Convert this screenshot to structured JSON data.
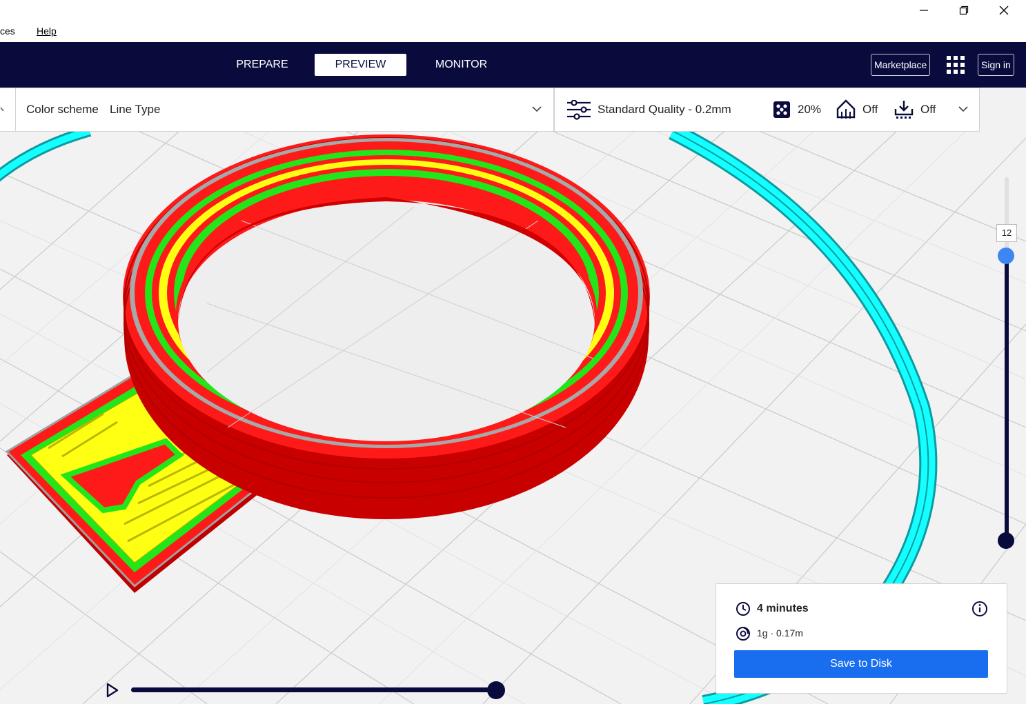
{
  "window_controls": {
    "minimize": "minimize",
    "restore": "restore",
    "close": "close"
  },
  "menu": {
    "items": [
      {
        "label": "ces"
      },
      {
        "label": "Help"
      }
    ]
  },
  "stages": [
    {
      "label": "PREPARE"
    },
    {
      "label": "PREVIEW",
      "active": true
    },
    {
      "label": "MONITOR"
    }
  ],
  "header": {
    "marketplace": "Marketplace",
    "sign_in": "Sign in"
  },
  "color_scheme": {
    "label": "Color scheme",
    "value": "Line Type"
  },
  "print_settings": {
    "profile": "Standard Quality - 0.2mm",
    "infill": "20%",
    "support": "Off",
    "adhesion": "Off"
  },
  "layer_slider": {
    "current_layer": "12"
  },
  "job": {
    "time": "4 minutes",
    "material": "1g · 0.17m",
    "save_label": "Save to Disk"
  },
  "colors": {
    "header": "#0a0b3d",
    "accent": "#196ef0",
    "wall_outer": "#ff1a1a",
    "wall_inner": "#22e61a",
    "skin": "#ffff14",
    "travel": "#00ffff"
  }
}
